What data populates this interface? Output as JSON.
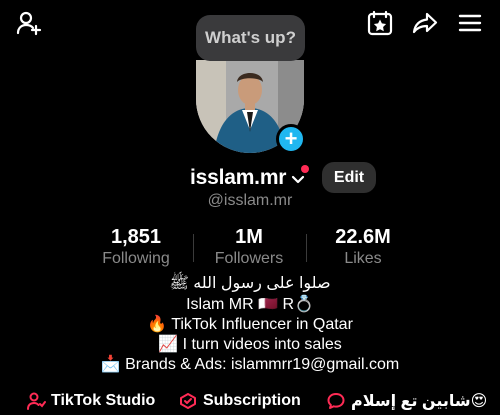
{
  "header": {
    "bubble_text": "What's up?",
    "icons": [
      "add-friend-icon",
      "calendar-star-icon",
      "share-icon",
      "menu-icon"
    ]
  },
  "profile": {
    "username": "isslam.mr",
    "handle": "@isslam.mr",
    "edit_label": "Edit",
    "add_badge": "+"
  },
  "stats": [
    {
      "value": "1,851",
      "label": "Following"
    },
    {
      "value": "1M",
      "label": "Followers"
    },
    {
      "value": "22.6M",
      "label": "Likes"
    }
  ],
  "bio": {
    "line1": "صلوا على رسول الله ﷺ",
    "line2": "Islam MR 🇶🇦 R💍",
    "line3": "🔥 TikTok Influencer in Qatar",
    "line4": "📈 I turn videos into sales",
    "line5": "📩 Brands & Ads: islammrr19@gmail.com"
  },
  "bottom_links": {
    "studio": "TikTok Studio",
    "subscription": "Subscription",
    "arabic": "شابين تع إسلام😍"
  },
  "colors": {
    "accent_pink": "#ff2b55",
    "badge_blue": "#20b7f0",
    "secondary_text": "#8a8a8a"
  }
}
